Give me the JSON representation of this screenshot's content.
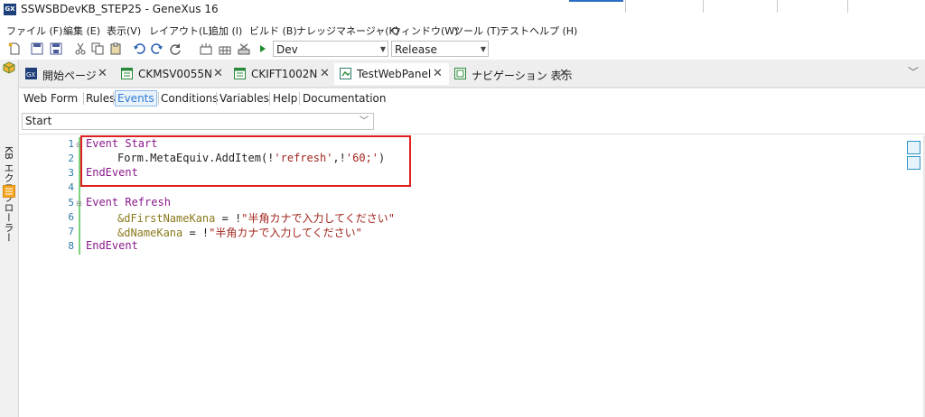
{
  "window": {
    "title": "SSWSBDevKB_STEP25 - GeneXus 16",
    "app_icon_text": "GX"
  },
  "menu": [
    {
      "label": "ファイル (F)"
    },
    {
      "label": "編集 (E)"
    },
    {
      "label": "表示(V)"
    },
    {
      "label": "レイアウト(L)"
    },
    {
      "label": "追加 (I)"
    },
    {
      "label": "ビルド (B)"
    },
    {
      "label": "ナレッジマネージャ(K)"
    },
    {
      "label": "ウィンドウ(W)"
    },
    {
      "label": "ツール (T)"
    },
    {
      "label": "テスト"
    },
    {
      "label": "ヘルプ (H)"
    }
  ],
  "toolbar": {
    "environment_value": "Dev",
    "configuration_value": "Release"
  },
  "left_strip": {
    "label": "KB エクスプローラー"
  },
  "tabs": [
    {
      "label": "開始ページ",
      "icon": "gx-start-icon",
      "active": false
    },
    {
      "label": "CKMSV0055N",
      "icon": "transaction-icon",
      "active": false
    },
    {
      "label": "CKIFT1002N",
      "icon": "transaction-icon",
      "active": false
    },
    {
      "label": "TestWebPanel",
      "icon": "webpanel-icon",
      "active": true
    },
    {
      "label": "ナビゲーション 表示",
      "icon": "navigation-icon",
      "active": false
    }
  ],
  "subtabs": [
    {
      "label": "Web Form",
      "selected": false
    },
    {
      "label": "Rules",
      "selected": false
    },
    {
      "label": "Events",
      "selected": true
    },
    {
      "label": "Conditions",
      "selected": false
    },
    {
      "label": "Variables",
      "selected": false
    },
    {
      "label": "Help",
      "selected": false
    },
    {
      "label": "Documentation",
      "selected": false
    }
  ],
  "event_selector": {
    "value": "Start"
  },
  "code": {
    "line_numbers": [
      "1",
      "2",
      "3",
      "4",
      "5",
      "6",
      "7",
      "8"
    ],
    "l1_kw": "Event Start",
    "l2_plain_a": "Form.MetaEquiv.AddItem(!",
    "l2_str_a": "'refresh'",
    "l2_plain_b": ",!",
    "l2_str_b": "'60;'",
    "l2_plain_c": ")",
    "l3_kw": "EndEvent",
    "l5_kw": "Event Refresh",
    "l6_var": "&dFirstNameKana",
    "l6_op": " = !",
    "l6_str": "\"半角カナで入力してください\"",
    "l7_var": "&dNameKana",
    "l7_op": " = !",
    "l7_str": "\"半角カナで入力してください\"",
    "l8_kw": "EndEvent"
  },
  "colors": {
    "keyword": "#8b1a8b",
    "string": "#a0261e",
    "variable": "#8a7a1e",
    "highlight_box": "#e02020",
    "selected_subtab": "#2f7bd3"
  }
}
